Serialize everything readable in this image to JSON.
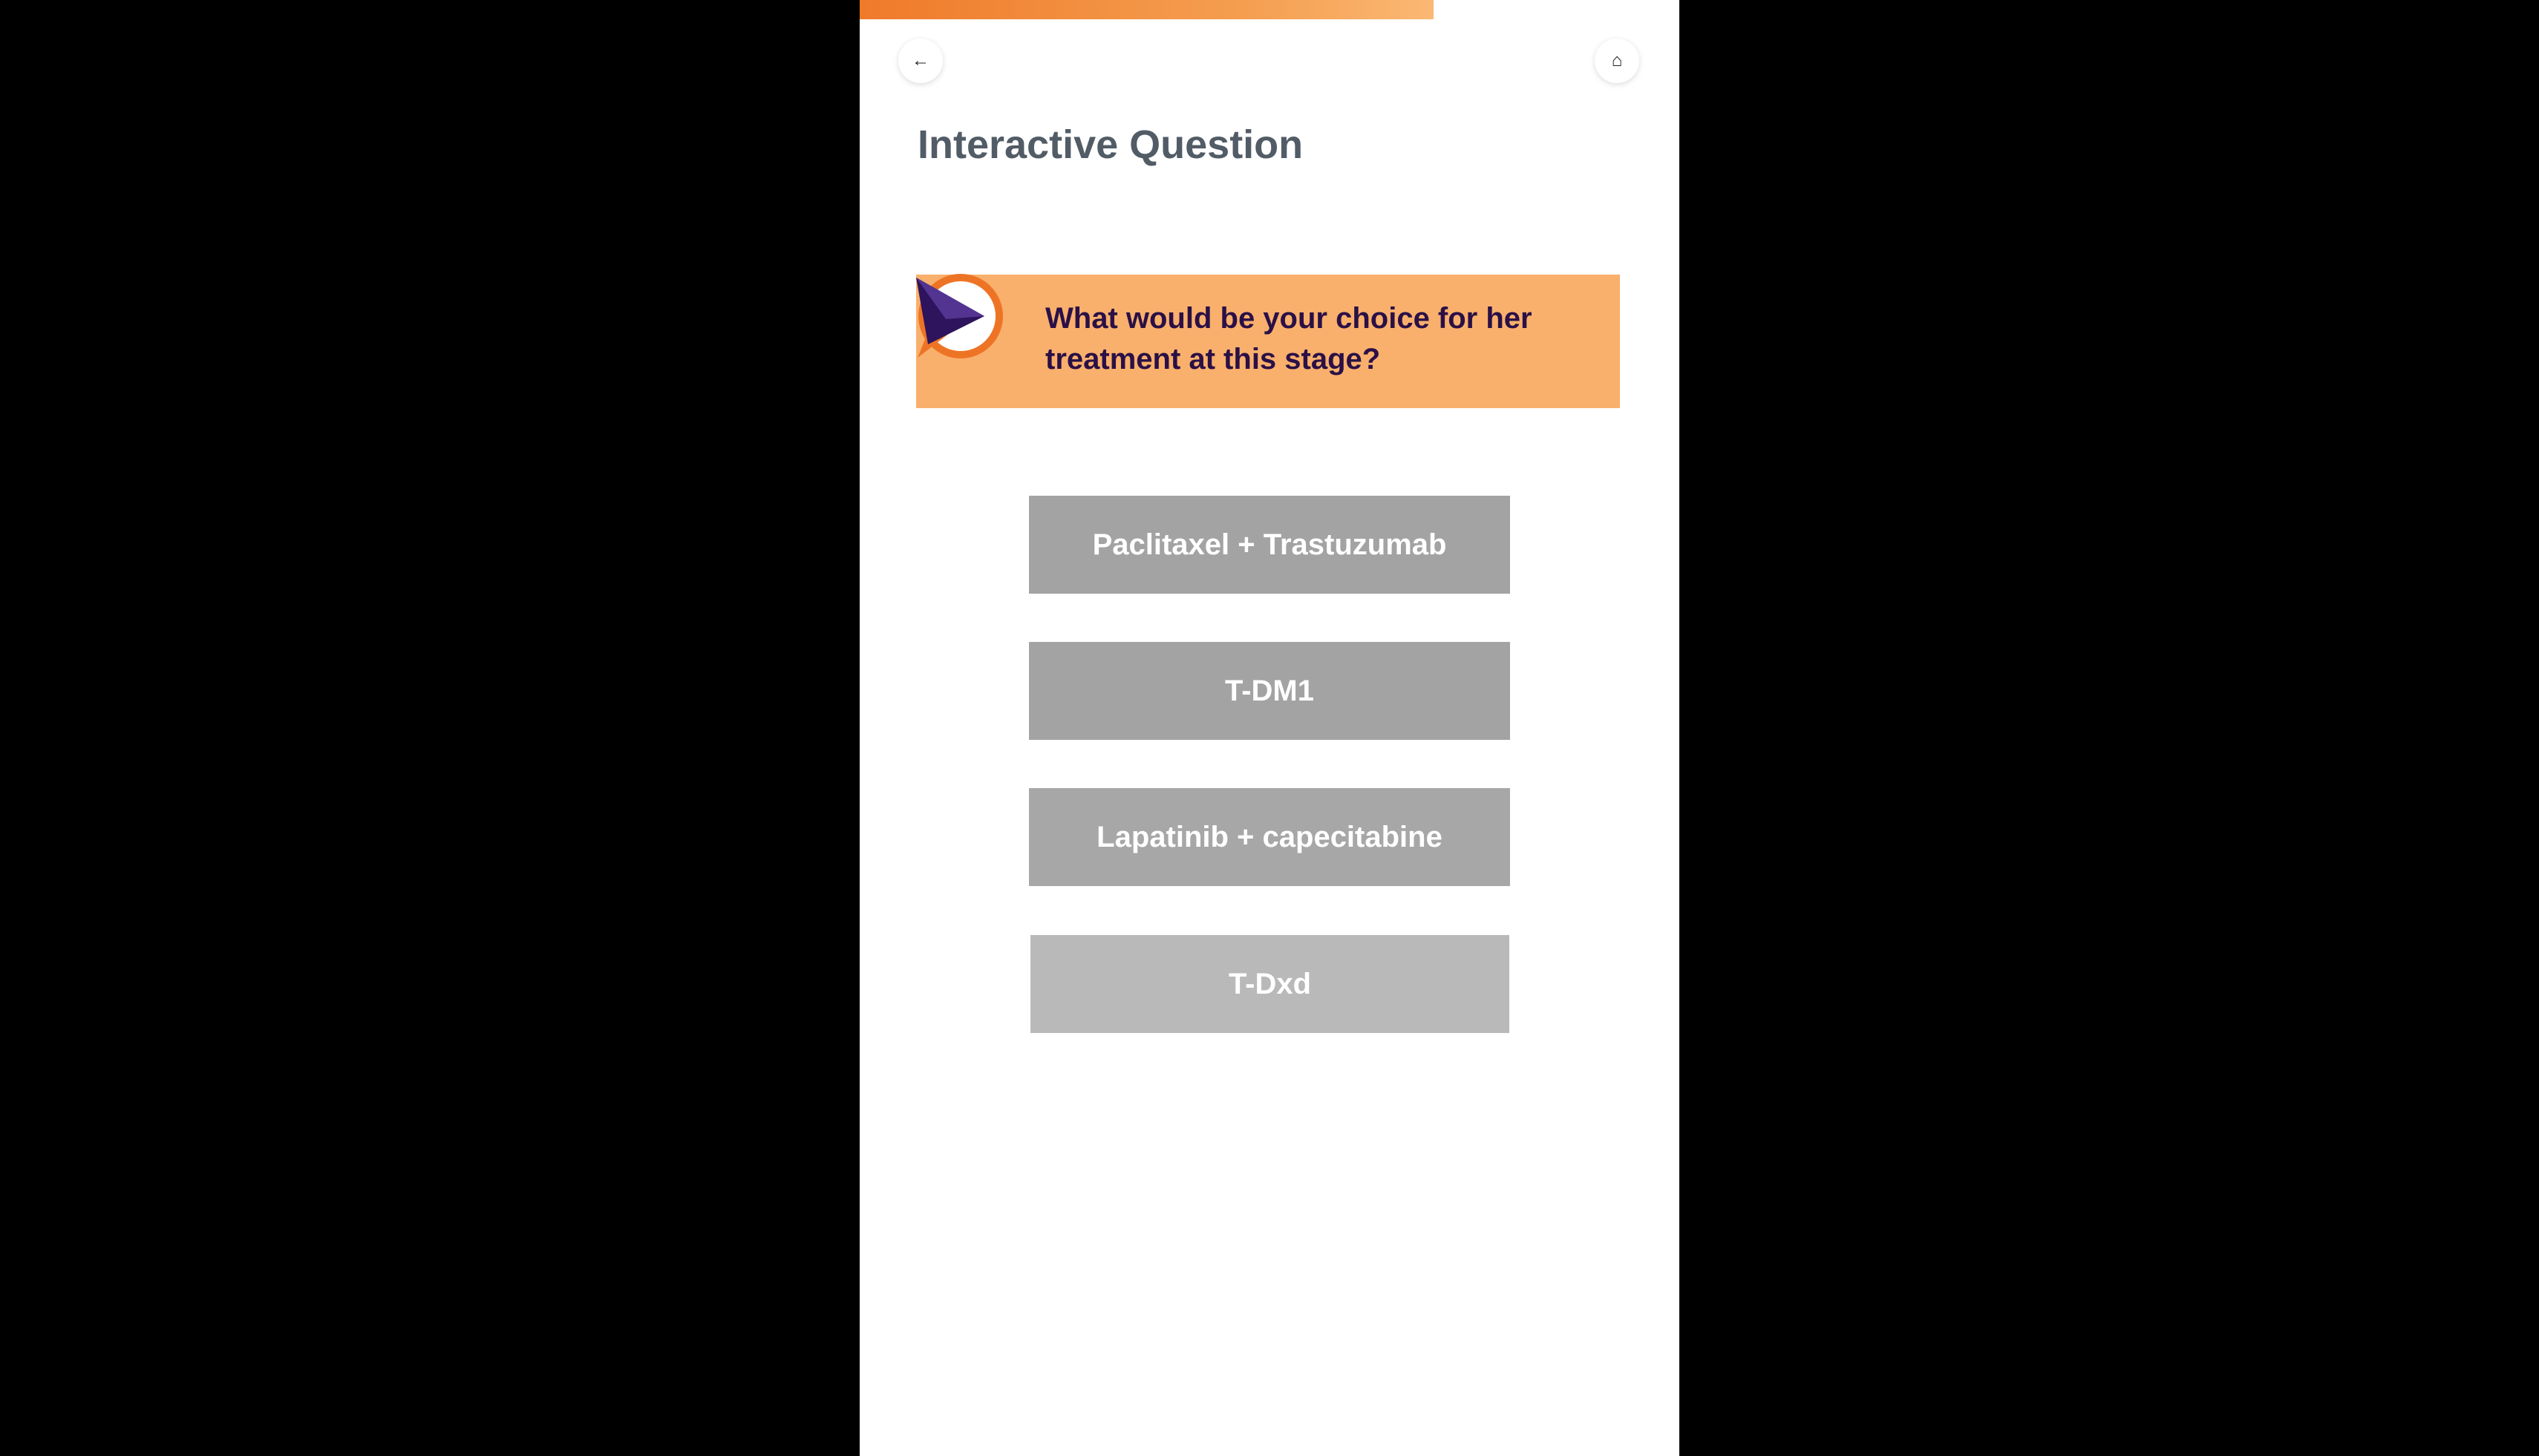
{
  "progress": {
    "fraction": 0.7,
    "colors": {
      "start": "#ef7a2a",
      "end": "#fbb874"
    }
  },
  "nav": {
    "back_icon": "arrow-left-icon",
    "back_glyph": "←",
    "home_icon": "home-icon",
    "home_glyph": "⌂"
  },
  "page": {
    "title": "Interactive Question"
  },
  "question": {
    "text": "What would be your choice for her treatment at this stage?",
    "banner_color": "#f9b06c",
    "text_color": "#2a1046",
    "logo_icon": "play-pointer-logo"
  },
  "options": [
    {
      "label": "Paclitaxel + Trastuzumab"
    },
    {
      "label": "T-DM1"
    },
    {
      "label": "Lapatinib + capecitabine"
    },
    {
      "label": "T-Dxd"
    }
  ]
}
